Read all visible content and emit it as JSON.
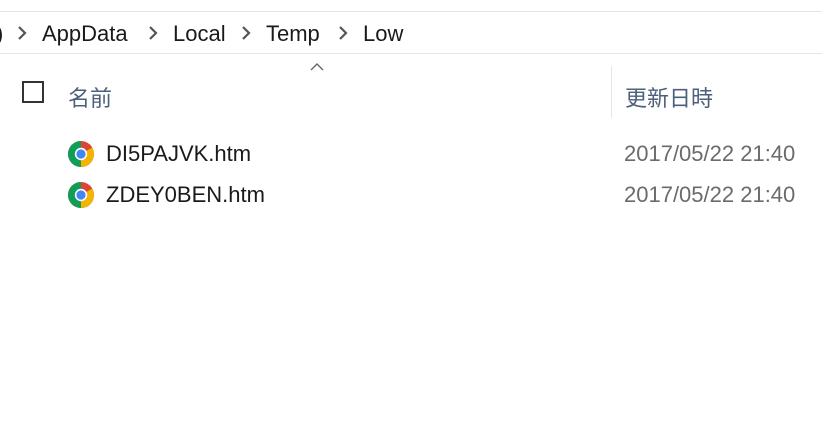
{
  "breadcrumb": {
    "lead": ")",
    "items": [
      "AppData",
      "Local",
      "Temp",
      "Low"
    ]
  },
  "header": {
    "name_label": "名前",
    "date_label": "更新日時",
    "sort_indicator": "^"
  },
  "files": [
    {
      "name": "DI5PAJVK.htm",
      "modified": "2017/05/22 21:40",
      "icon": "chrome-html-icon"
    },
    {
      "name": "ZDEY0BEN.htm",
      "modified": "2017/05/22 21:40",
      "icon": "chrome-html-icon"
    }
  ],
  "colors": {
    "header_text": "#4c607a",
    "date_text": "#6b6b6b",
    "divider": "#e5e5e5"
  }
}
